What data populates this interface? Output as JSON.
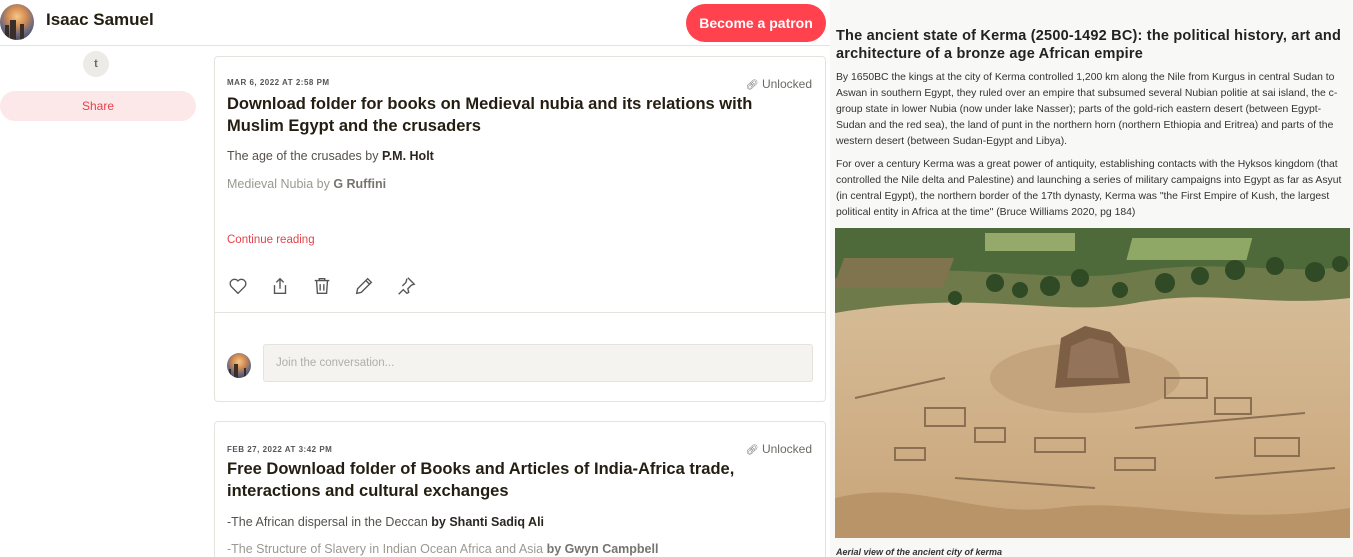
{
  "creator": {
    "name": "Isaac Samuel",
    "patron_button": "Become a patron"
  },
  "sidebar": {
    "twitter_glyph": "t",
    "share_label": "Share"
  },
  "posts": [
    {
      "date": "MAR 6, 2022 AT 2:58 PM",
      "status": "Unlocked",
      "title": "Download folder for books on Medieval nubia and its relations with Muslim Egypt and the crusaders",
      "lines": [
        {
          "text": "The age of the crusades by ",
          "bold": "P.M. Holt"
        },
        {
          "text": "Medieval Nubia by ",
          "bold": "G Ruffini"
        }
      ],
      "continue_label": "Continue reading",
      "comment_placeholder": "Join the conversation..."
    },
    {
      "date": "FEB 27, 2022 AT 3:42 PM",
      "status": "Unlocked",
      "title": "Free Download folder of Books and Articles of India-Africa trade, interactions and cultural exchanges",
      "lines": [
        {
          "text": "-The African dispersal in the Deccan ",
          "bold": "by Shanti Sadiq Ali"
        },
        {
          "text": "-The Structure of Slavery in Indian Ocean Africa and Asia ",
          "bold": "by Gwyn Campbell"
        }
      ]
    }
  ],
  "article": {
    "title": "The ancient state of Kerma (2500-1492 BC): the political history, art and architecture of a bronze age African empire",
    "para1": "By 1650BC the kings at the city of Kerma controlled 1,200 km along the Nile from Kurgus in central Sudan to Aswan in southern Egypt, they ruled over an empire that subsumed several Nubian politie at sai island, the c-group state in lower Nubia (now under lake Nasser); parts of the gold-rich eastern desert (between Egypt-Sudan and the red sea), the land of punt in the northern horn (northern Ethiopia and Eritrea) and parts of the western desert (between Sudan-Egypt and Libya).",
    "para2": "For over a century Kerma was a great power of antiquity, establishing contacts with the Hyksos kingdom (that controlled the Nile delta and Palestine) and launching a series of military campaigns into Egypt as far as Asyut (in central Egypt), the northern border of the 17th dynasty, Kerma was \"the First Empire of Kush, the largest political entity in Africa at the time\" (Bruce Williams 2020, pg 184)",
    "caption": "Aerial view of the ancient city of kerma"
  },
  "colors": {
    "accent": "#ff424d",
    "link": "#e6424a",
    "share_bg": "#fde8e9"
  }
}
